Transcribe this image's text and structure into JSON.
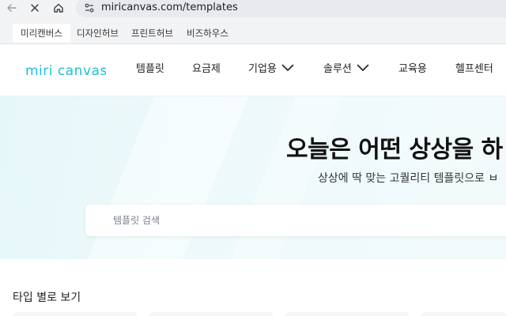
{
  "browser": {
    "back_icon": "back-arrow-icon",
    "close_icon": "close-icon",
    "home_icon": "home-icon",
    "site_info_icon": "site-info-icon",
    "url": "miricanvas.com/templates"
  },
  "family_tabs": [
    {
      "label": "미리캔버스",
      "active": true
    },
    {
      "label": "디자인허브",
      "active": false
    },
    {
      "label": "프린트허브",
      "active": false
    },
    {
      "label": "비즈하우스",
      "active": false
    }
  ],
  "nav": {
    "logo_text": "miri canvas",
    "brand_color": "#1fc0d5",
    "items": [
      {
        "label": "템플릿",
        "has_dropdown": false
      },
      {
        "label": "요금제",
        "has_dropdown": false
      },
      {
        "label": "기업용",
        "has_dropdown": true
      },
      {
        "label": "솔루션",
        "has_dropdown": true
      },
      {
        "label": "교육용",
        "has_dropdown": false
      },
      {
        "label": "헬프센터",
        "has_dropdown": false
      }
    ]
  },
  "hero": {
    "title": "오늘은 어떤 상상을 하",
    "subtitle": "상상에 딱 맞는 고퀄리티 템플릿으로 ㅂ",
    "search_placeholder": "템플릿 검색"
  },
  "section": {
    "title": "타입 별로 보기"
  }
}
